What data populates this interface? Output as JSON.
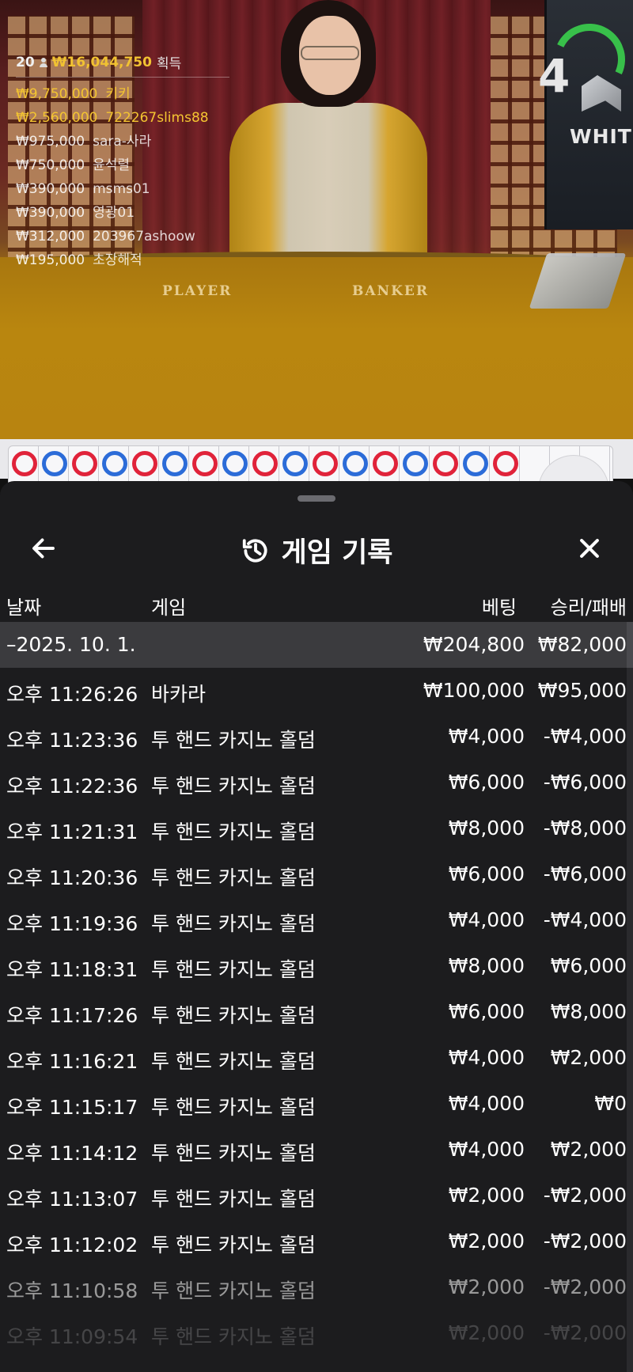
{
  "colors": {
    "accent_gold": "#f4c531",
    "sheet_bg": "#1c1c1e",
    "banker_red": "#e0233a",
    "player_blue": "#2c6cd8"
  },
  "video": {
    "table_labels": {
      "player": "PLAYER",
      "banker": "BANKER"
    },
    "promo": {
      "digit": "4",
      "word": "WHITE"
    }
  },
  "winners": {
    "count": "20",
    "total": "₩16,044,750",
    "suffix": "획득",
    "rows": [
      {
        "amount": "₩9,750,000",
        "name": "키키"
      },
      {
        "amount": "₩2,560,000",
        "name": "722267slims88"
      },
      {
        "amount": "₩975,000",
        "name": "sara-사라"
      },
      {
        "amount": "₩750,000",
        "name": "윤석렬"
      },
      {
        "amount": "₩390,000",
        "name": "msms01"
      },
      {
        "amount": "₩390,000",
        "name": "영광01"
      },
      {
        "amount": "₩312,000",
        "name": "203967ashoow"
      },
      {
        "amount": "₩195,000",
        "name": "초장해적"
      }
    ]
  },
  "road": {
    "beads": [
      "B",
      "P",
      "B",
      "P",
      "B",
      "P",
      "B",
      "P",
      "B",
      "P",
      "B",
      "P",
      "B",
      "P",
      "B",
      "P",
      "B"
    ]
  },
  "sheet": {
    "title": "게임 기록",
    "icons": {
      "back": "arrow-left-icon",
      "history": "history-icon",
      "close": "close-icon"
    },
    "columns": {
      "date": "날짜",
      "game": "게임",
      "bet": "베팅",
      "winloss": "승리/패배"
    },
    "summary": {
      "date": "–2025. 10. 1.",
      "bet": "₩204,800",
      "winloss": "₩82,000"
    },
    "rows": [
      {
        "time": "오후 11:26:26",
        "game": "바카라",
        "bet": "₩100,000",
        "winloss": "₩95,000"
      },
      {
        "time": "오후 11:23:36",
        "game": "투 핸드 카지노 홀덤",
        "bet": "₩4,000",
        "winloss": "-₩4,000"
      },
      {
        "time": "오후 11:22:36",
        "game": "투 핸드 카지노 홀덤",
        "bet": "₩6,000",
        "winloss": "-₩6,000"
      },
      {
        "time": "오후 11:21:31",
        "game": "투 핸드 카지노 홀덤",
        "bet": "₩8,000",
        "winloss": "-₩8,000"
      },
      {
        "time": "오후 11:20:36",
        "game": "투 핸드 카지노 홀덤",
        "bet": "₩6,000",
        "winloss": "-₩6,000"
      },
      {
        "time": "오후 11:19:36",
        "game": "투 핸드 카지노 홀덤",
        "bet": "₩4,000",
        "winloss": "-₩4,000"
      },
      {
        "time": "오후 11:18:31",
        "game": "투 핸드 카지노 홀덤",
        "bet": "₩8,000",
        "winloss": "₩6,000"
      },
      {
        "time": "오후 11:17:26",
        "game": "투 핸드 카지노 홀덤",
        "bet": "₩6,000",
        "winloss": "₩8,000"
      },
      {
        "time": "오후 11:16:21",
        "game": "투 핸드 카지노 홀덤",
        "bet": "₩4,000",
        "winloss": "₩2,000"
      },
      {
        "time": "오후 11:15:17",
        "game": "투 핸드 카지노 홀덤",
        "bet": "₩4,000",
        "winloss": "₩0"
      },
      {
        "time": "오후 11:14:12",
        "game": "투 핸드 카지노 홀덤",
        "bet": "₩4,000",
        "winloss": "₩2,000"
      },
      {
        "time": "오후 11:13:07",
        "game": "투 핸드 카지노 홀덤",
        "bet": "₩2,000",
        "winloss": "-₩2,000"
      },
      {
        "time": "오후 11:12:02",
        "game": "투 핸드 카지노 홀덤",
        "bet": "₩2,000",
        "winloss": "-₩2,000"
      },
      {
        "time": "오후 11:10:58",
        "game": "투 핸드 카지노 홀덤",
        "bet": "₩2,000",
        "winloss": "-₩2,000"
      },
      {
        "time": "오후 11:09:54",
        "game": "투 핸드 카지노 홀덤",
        "bet": "₩2,000",
        "winloss": "-₩2,000"
      }
    ]
  }
}
